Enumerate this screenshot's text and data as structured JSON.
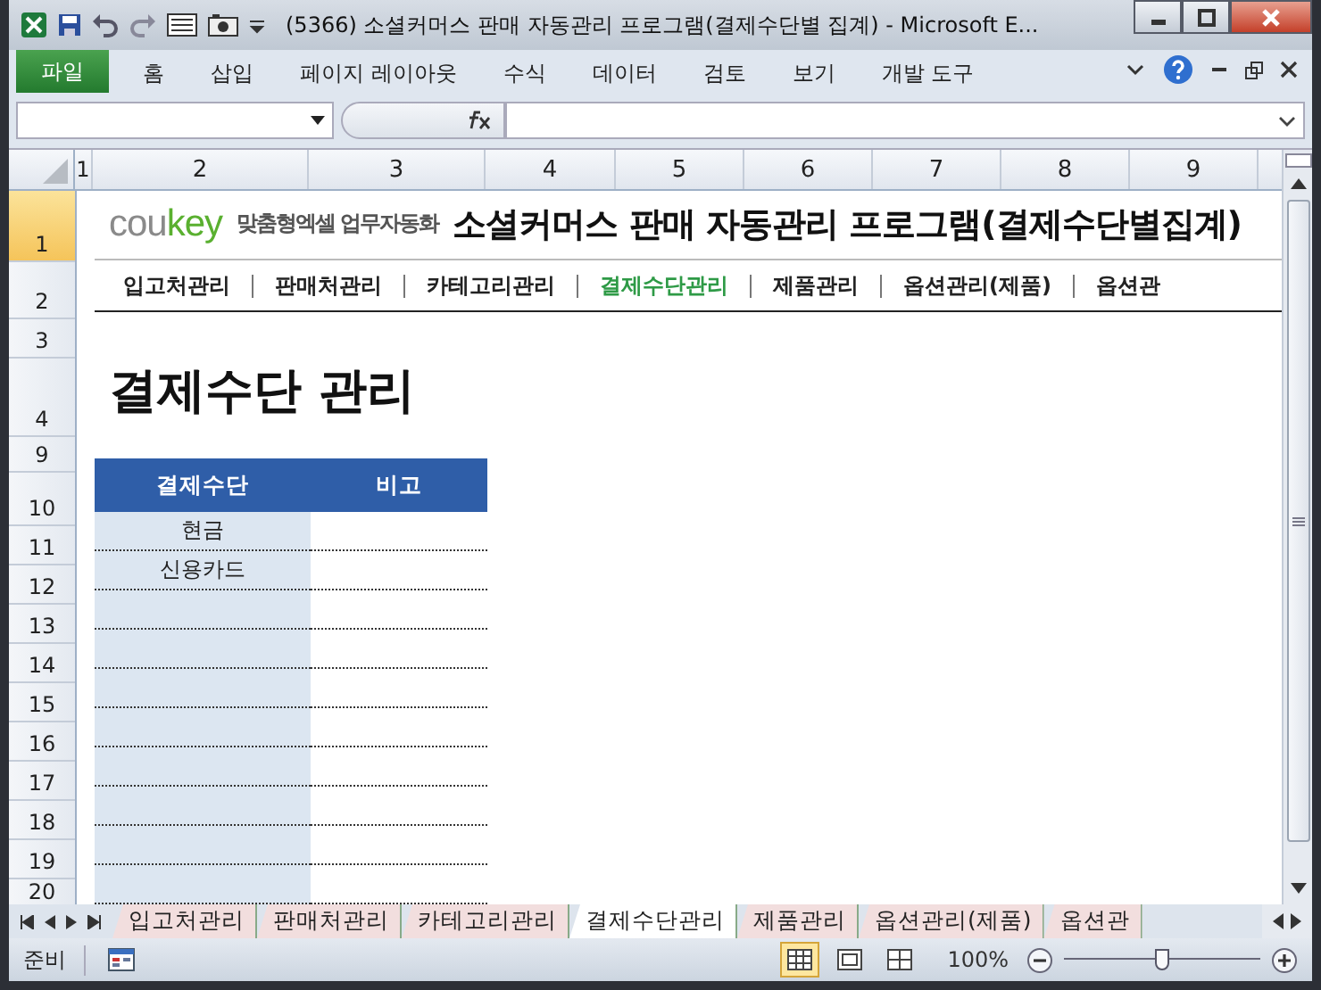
{
  "window": {
    "title": "(5366) 소셜커머스 판매 자동관리 프로그램(결제수단별 집계)  -  Microsoft E..."
  },
  "ribbon_tabs": [
    {
      "label": "파일",
      "kind": "file",
      "selected": false
    },
    {
      "label": "홈",
      "kind": "tab",
      "selected": false
    },
    {
      "label": "삽입",
      "kind": "tab",
      "selected": false
    },
    {
      "label": "페이지 레이아웃",
      "kind": "tab",
      "selected": false
    },
    {
      "label": "수식",
      "kind": "tab",
      "selected": false
    },
    {
      "label": "데이터",
      "kind": "tab",
      "selected": false
    },
    {
      "label": "검토",
      "kind": "tab",
      "selected": false
    },
    {
      "label": "보기",
      "kind": "tab",
      "selected": false
    },
    {
      "label": "개발 도구",
      "kind": "tab",
      "selected": false
    }
  ],
  "column_headers": [
    "1",
    "2",
    "3",
    "4",
    "5",
    "6",
    "7",
    "8",
    "9"
  ],
  "row_headers": [
    {
      "label": "1",
      "selected": true
    },
    {
      "label": "2",
      "selected": false
    },
    {
      "label": "3",
      "selected": false
    },
    {
      "label": "4",
      "selected": false
    },
    {
      "label": "9",
      "selected": false
    },
    {
      "label": "10",
      "selected": false
    },
    {
      "label": "11",
      "selected": false
    },
    {
      "label": "12",
      "selected": false
    },
    {
      "label": "13",
      "selected": false
    },
    {
      "label": "14",
      "selected": false
    },
    {
      "label": "15",
      "selected": false
    },
    {
      "label": "16",
      "selected": false
    },
    {
      "label": "17",
      "selected": false
    },
    {
      "label": "18",
      "selected": false
    },
    {
      "label": "19",
      "selected": false
    },
    {
      "label": "20",
      "selected": false
    }
  ],
  "logo": {
    "brand_grey": "cou",
    "brand_green": "key",
    "tagline": "맞춤형엑셀 업무자동화"
  },
  "heading": "소셜커머스 판매 자동관리 프로그램(결제수단별집계)",
  "nav_links": [
    {
      "label": "입고처관리",
      "selected": false
    },
    {
      "label": "판매처관리",
      "selected": false
    },
    {
      "label": "카테고리관리",
      "selected": false
    },
    {
      "label": "결제수단관리",
      "selected": true
    },
    {
      "label": "제품관리",
      "selected": false
    },
    {
      "label": "옵션관리(제품)",
      "selected": false
    },
    {
      "label": "옵션관",
      "selected": false
    }
  ],
  "page_title": "결제수단 관리",
  "table": {
    "columns": [
      "결제수단",
      "비고"
    ],
    "rows": [
      {
        "method": "현금"
      },
      {
        "method": "신용카드"
      }
    ]
  },
  "sheet_tabs": [
    {
      "label": "입고처관리",
      "selected": false
    },
    {
      "label": "판매처관리",
      "selected": false
    },
    {
      "label": "카테고리관리",
      "selected": false
    },
    {
      "label": "결제수단관리",
      "selected": true
    },
    {
      "label": "제품관리",
      "selected": false
    },
    {
      "label": "옵션관리(제품)",
      "selected": false
    },
    {
      "label": "옵션관",
      "selected": false
    }
  ],
  "status_bar": {
    "status": "준비",
    "zoom": "100%",
    "zoom_slider": {
      "level": 0.5
    },
    "views": [
      {
        "kind": "normal",
        "selected": true
      },
      {
        "kind": "layout",
        "selected": false
      },
      {
        "kind": "pagebreak",
        "selected": false
      }
    ]
  }
}
